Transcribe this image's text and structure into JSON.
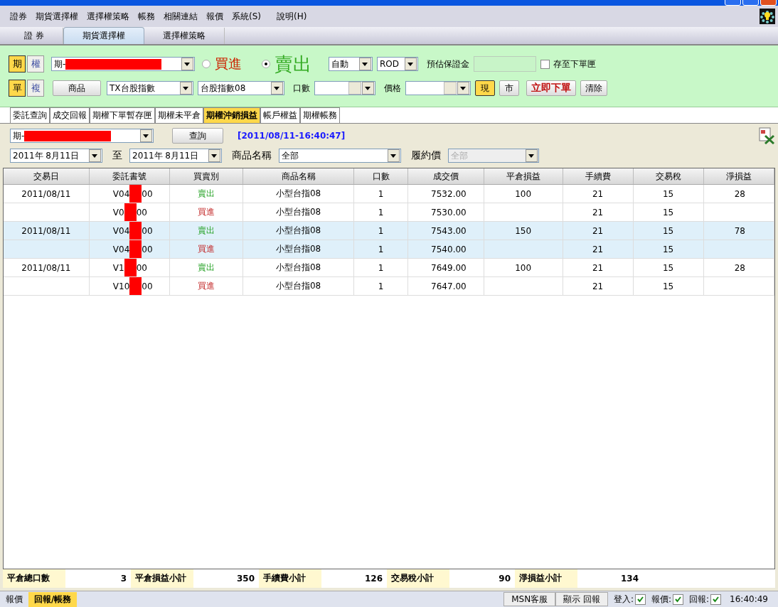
{
  "menu": [
    "證券",
    "期貨選擇權",
    "選擇權策略",
    "帳務",
    "相關連結",
    "報價",
    "系統(S)",
    "說明(H)"
  ],
  "main_tabs": [
    {
      "label": "證 券",
      "selected": false
    },
    {
      "label": "期貨選擇權",
      "selected": true
    },
    {
      "label": "選擇權策略",
      "selected": false
    }
  ],
  "order_panel": {
    "type_toggle": [
      {
        "label": "期",
        "selected": true
      },
      {
        "label": "權",
        "selected": false
      }
    ],
    "mode_toggle": [
      {
        "label": "單",
        "selected": true
      },
      {
        "label": "複",
        "selected": false
      }
    ],
    "account": "期-",
    "sides": [
      {
        "label": "買進",
        "selected": false,
        "color": "#cc2200"
      },
      {
        "label": "賣出",
        "selected": true,
        "color": "#33aa22"
      }
    ],
    "condition": "自動",
    "time_in_force": "ROD",
    "margin_label": "預估保證金",
    "save_label": "存至下單匣",
    "save_checked": false,
    "product_button": "商品",
    "product": "TX台股指數",
    "contract": "台股指數08",
    "qty_label": "口數",
    "price_label": "價格",
    "price_types": [
      {
        "label": "現",
        "selected": true
      },
      {
        "label": "市",
        "selected": false
      }
    ],
    "submit": "立即下單",
    "clear": "清除"
  },
  "sub_tabs": [
    {
      "label": "委託查詢",
      "selected": false
    },
    {
      "label": "成交回報",
      "selected": false
    },
    {
      "label": "期權下單暫存匣",
      "selected": false
    },
    {
      "label": "期權未平倉",
      "selected": false
    },
    {
      "label": "期權沖銷損益",
      "selected": true
    },
    {
      "label": "帳戶權益",
      "selected": false
    },
    {
      "label": "期權帳務",
      "selected": false
    }
  ],
  "query": {
    "account": "期-",
    "button": "查詢",
    "timestamp": "[2011/08/11-16:40:47]",
    "date_from": "2011年  8月11日",
    "to_label": "至",
    "date_to": "2011年  8月11日",
    "product_label": "商品名稱",
    "product": "全部",
    "strike_label": "履約價",
    "strike": "全部"
  },
  "table": {
    "columns": [
      "交易日",
      "委託書號",
      "買賣別",
      "商品名稱",
      "口數",
      "成交價",
      "平倉損益",
      "手續費",
      "交易稅",
      "淨損益"
    ],
    "rows": [
      {
        "selected": false,
        "date": "2011/08/11",
        "order_prefix": "V04",
        "order_suffix": "00",
        "side": "賣出",
        "kind": "sell",
        "product": "小型台指08",
        "qty": "1",
        "price": "7532.00",
        "pl": "100",
        "fee": "21",
        "tax": "15",
        "net": "28"
      },
      {
        "selected": false,
        "date": "",
        "order_prefix": "V0",
        "order_suffix": "00",
        "side": "買進",
        "kind": "buy",
        "product": "小型台指08",
        "qty": "1",
        "price": "7530.00",
        "pl": "",
        "fee": "21",
        "tax": "15",
        "net": ""
      },
      {
        "selected": true,
        "date": "2011/08/11",
        "order_prefix": "V04",
        "order_suffix": "00",
        "side": "賣出",
        "kind": "sell",
        "product": "小型台指08",
        "qty": "1",
        "price": "7543.00",
        "pl": "150",
        "fee": "21",
        "tax": "15",
        "net": "78"
      },
      {
        "selected": true,
        "date": "",
        "order_prefix": "V04",
        "order_suffix": "00",
        "side": "買進",
        "kind": "buy",
        "product": "小型台指08",
        "qty": "1",
        "price": "7540.00",
        "pl": "",
        "fee": "21",
        "tax": "15",
        "net": ""
      },
      {
        "selected": false,
        "date": "2011/08/11",
        "order_prefix": "V1",
        "order_suffix": "00",
        "side": "賣出",
        "kind": "sell",
        "product": "小型台指08",
        "qty": "1",
        "price": "7649.00",
        "pl": "100",
        "fee": "21",
        "tax": "15",
        "net": "28"
      },
      {
        "selected": false,
        "date": "",
        "order_prefix": "V10",
        "order_suffix": "00",
        "side": "買進",
        "kind": "buy",
        "product": "小型台指08",
        "qty": "1",
        "price": "7647.00",
        "pl": "",
        "fee": "21",
        "tax": "15",
        "net": ""
      }
    ]
  },
  "summary": [
    {
      "label": "平倉總口數",
      "value": "3"
    },
    {
      "label": "平倉損益小計",
      "value": "350"
    },
    {
      "label": "手續費小計",
      "value": "126"
    },
    {
      "label": "交易稅小計",
      "value": "90"
    },
    {
      "label": "淨損益小計",
      "value": "134"
    }
  ],
  "bottom_tabs": [
    {
      "label": "報價",
      "selected": false
    },
    {
      "label": "回報/帳務",
      "selected": true
    }
  ],
  "status": {
    "msn": "MSN客服",
    "show_report": "顯示 回報",
    "checks": [
      {
        "label": "登入:",
        "checked": true
      },
      {
        "label": "報價:",
        "checked": true
      },
      {
        "label": "回報:",
        "checked": true
      }
    ],
    "time": "16:40:49"
  }
}
